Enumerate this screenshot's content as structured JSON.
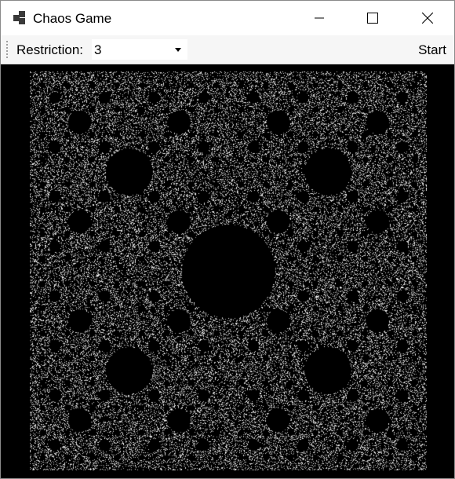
{
  "window": {
    "title": "Chaos Game",
    "app_icon": "app-icon",
    "controls": [
      "minimize-icon",
      "maximize-icon",
      "close-icon"
    ]
  },
  "toolbar": {
    "restriction_label": "Restriction:",
    "restriction_value": "3",
    "start_label": "Start"
  },
  "canvas": {
    "background": "#000000",
    "point_color": "#ffffff"
  }
}
